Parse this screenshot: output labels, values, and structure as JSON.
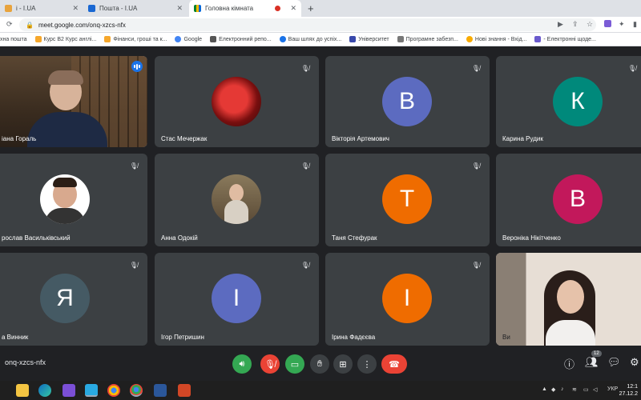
{
  "browser": {
    "tabs": [
      {
        "title": "і - I.UA",
        "active": false
      },
      {
        "title": "Пошта - I.UA",
        "active": false
      },
      {
        "title": "Головна кімната",
        "active": true
      }
    ],
    "url": "meet.google.com/onq-xzcs-nfx",
    "bookmarks": [
      {
        "label": "хна пошта"
      },
      {
        "label": "Курс B2 Курс англі..."
      },
      {
        "label": "Фінанси, гроші та к..."
      },
      {
        "label": "Google"
      },
      {
        "label": "Електронний репо..."
      },
      {
        "label": "Ваш шлях до успіх..."
      },
      {
        "label": "Університет"
      },
      {
        "label": "Програмне забезп..."
      },
      {
        "label": "Нові знання - Вхід..."
      },
      {
        "label": "- Електронні щоде..."
      }
    ]
  },
  "participants": [
    {
      "name": "іана Гораль",
      "type": "video",
      "speaking": true
    },
    {
      "name": "Стас Мечержак",
      "type": "photo",
      "muted": true
    },
    {
      "name": "Вікторія Артемович",
      "initial": "В",
      "color": "#5c6bc0",
      "muted": true
    },
    {
      "name": "Карина Рудик",
      "initial": "К",
      "color": "#00897b",
      "muted": true
    },
    {
      "name": "рослав Васильківський",
      "type": "photo",
      "muted": true
    },
    {
      "name": "Анна Одокій",
      "type": "photo",
      "muted": true
    },
    {
      "name": "Таня Стефурак",
      "initial": "Т",
      "color": "#ef6c00",
      "muted": true
    },
    {
      "name": "Вероніка Нікітченко",
      "initial": "В",
      "color": "#c2185b",
      "muted": true
    },
    {
      "name": "а Винник",
      "initial": "Я",
      "color": "#455a64",
      "muted": true
    },
    {
      "name": "Ігор Петришин",
      "initial": "І",
      "color": "#5c6bc0",
      "muted": true
    },
    {
      "name": "Ірина Фадєєва",
      "initial": "І",
      "color": "#ef6c00",
      "muted": true
    },
    {
      "name": "Ви",
      "type": "video"
    }
  ],
  "controls": {
    "meeting_code": "onq-xzcs-nfx",
    "people_count": "12"
  },
  "taskbar": {
    "language": "УКР",
    "time": "12:1",
    "date": "27.12.2"
  }
}
